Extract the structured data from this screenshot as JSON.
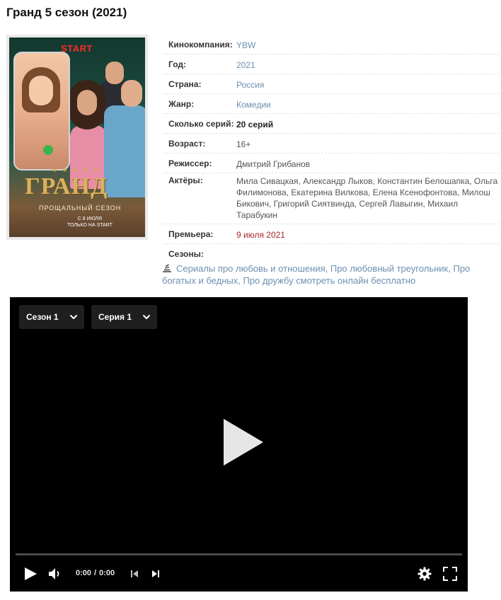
{
  "page": {
    "title": "Гранд 5 сезон (2021)"
  },
  "poster": {
    "logo": "START",
    "title": "ГРАНД",
    "subtitle": "ПРОЩАЛЬНЫЙ СЕЗОН",
    "date_line1": "С 8 ИЮЛЯ",
    "date_line2": "ТОЛЬКО НА START"
  },
  "info": {
    "studio_label": "Кинокомпания:",
    "studio": "YBW",
    "year_label": "Год:",
    "year": "2021",
    "country_label": "Страна:",
    "country": "Россия",
    "genre_label": "Жанр:",
    "genre": "Комедии",
    "episodes_label": "Сколько серий:",
    "episodes": "20 серий",
    "age_label": "Возраст:",
    "age": "16+",
    "director_label": "Режиссер:",
    "director": "Дмитрий Грибанов",
    "actors_label": "Актёры:",
    "actors": "Мила Сивацкая, Александр Лыков, Константин Белошапка, Ольга Филимонова, Екатерина Вилкова, Елена Ксенофонтова, Милош Бикович, Григорий Сиятвинда, Сергей Лавыгин, Михаил Тарабукин",
    "premiere_label": "Премьера:",
    "premiere": "9 июля 2021",
    "seasons_label": "Сезоны:"
  },
  "tags": [
    "Сериалы про любовь и отношения",
    "Про любовный треугольник",
    "Про богатых и бедных",
    "Про дружбу смотреть онлайн бесплатно"
  ],
  "player": {
    "season_select": "Сезон 1",
    "episode_select": "Серия 1",
    "current_time": "0:00",
    "duration": "0:00",
    "progress": 0
  },
  "colors": {
    "link": "#6d8fb0",
    "premiere": "#a6262a",
    "player_bg": "#000000"
  }
}
